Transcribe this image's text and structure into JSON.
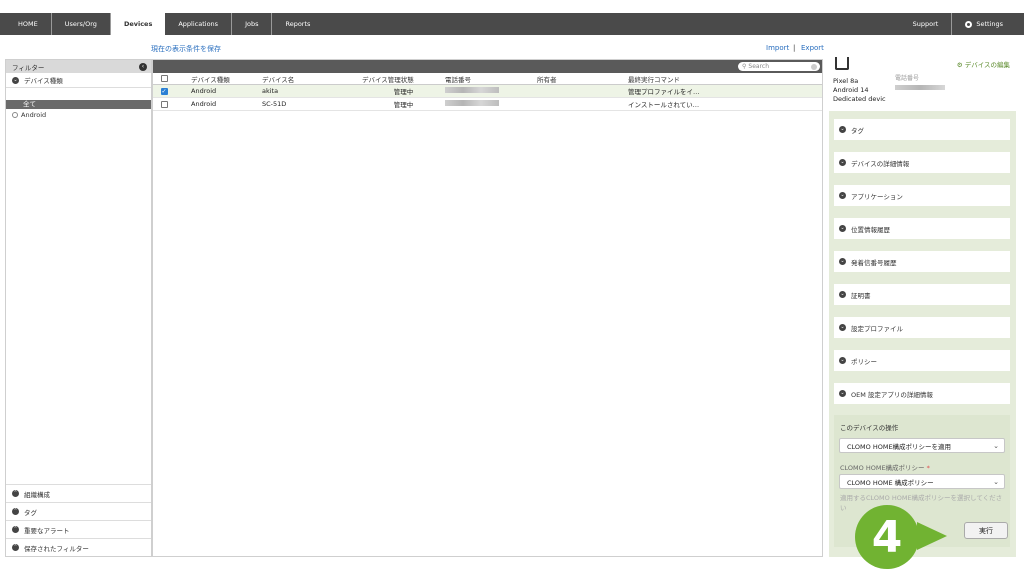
{
  "nav": {
    "items": [
      "HOME",
      "Users/Org",
      "Devices",
      "Applications",
      "Jobs",
      "Reports"
    ],
    "right": [
      "Support",
      "Settings"
    ]
  },
  "save_filter": "現在の表示条件を保存",
  "import": "Import",
  "export": "Export",
  "sidebar": {
    "header": "フィルター",
    "device_type": "デバイス種類",
    "selected": "全て",
    "item": "Android",
    "bottom": [
      "組織構成",
      "タグ",
      "重要なアラート",
      "保存されたフィルター"
    ]
  },
  "search_placeholder": "Search",
  "table": {
    "headers": [
      "デバイス種類",
      "デバイス名",
      "デバイス管理状態",
      "電話番号",
      "所有者",
      "最終実行コマンド"
    ],
    "rows": [
      {
        "checked": true,
        "type": "Android",
        "name": "akita",
        "status": "管理中",
        "owner": "",
        "last_cmd": "管理プロファイルをイ…"
      },
      {
        "checked": false,
        "type": "Android",
        "name": "SC-51D",
        "status": "管理中",
        "owner": "",
        "last_cmd": "インストールされてい…"
      }
    ]
  },
  "detail": {
    "edit": "デバイスの編集",
    "model": "Pixel 8a",
    "os": "Android 14",
    "mode": "Dedicated devic",
    "tel_label": "電話番号",
    "sections": [
      "タグ",
      "デバイスの詳細情報",
      "アプリケーション",
      "位置情報履歴",
      "発着信番号履歴",
      "証明書",
      "設定プロファイル",
      "ポリシー",
      "OEM 設定アプリの詳細情報"
    ],
    "ops_title": "このデバイスの操作",
    "action_select": "CLOMO HOME構成ポリシーを適用",
    "policy_label": "CLOMO HOME構成ポリシー",
    "required_mark": "*",
    "policy_select": "CLOMO HOME 構成ポリシー",
    "hint": "適用するCLOMO HOME構成ポリシーを選択してください",
    "exec": "実行"
  },
  "step_marker": "4"
}
